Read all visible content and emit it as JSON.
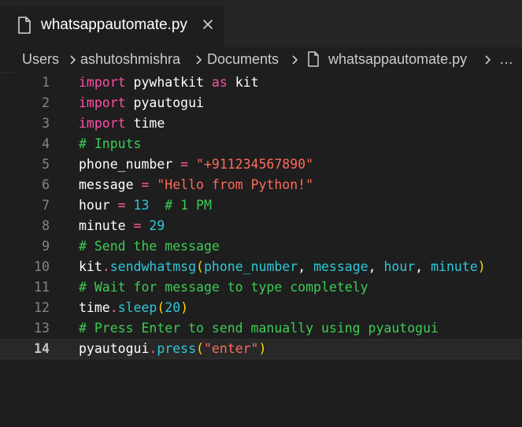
{
  "tab": {
    "label": "whatsappautomate.py",
    "icon": "file-icon",
    "close_icon": "close-icon"
  },
  "breadcrumb": {
    "items": [
      "Users",
      "ashutoshmishra",
      "Documents",
      "whatsappautomate.py",
      "…"
    ],
    "file_icon": "file-icon"
  },
  "editor": {
    "current_line": 14,
    "lines": [
      {
        "n": "1",
        "tokens": [
          [
            "kw",
            "import"
          ],
          [
            "id",
            " pywhatkit "
          ],
          [
            "kw",
            "as"
          ],
          [
            "id",
            " kit"
          ]
        ]
      },
      {
        "n": "2",
        "tokens": [
          [
            "kw",
            "import"
          ],
          [
            "id",
            " pyautogui"
          ]
        ]
      },
      {
        "n": "3",
        "tokens": [
          [
            "kw",
            "import"
          ],
          [
            "id",
            " time"
          ]
        ]
      },
      {
        "n": "4",
        "tokens": [
          [
            "cm",
            "# Inputs"
          ]
        ]
      },
      {
        "n": "5",
        "tokens": [
          [
            "id",
            "phone_number "
          ],
          [
            "op",
            "="
          ],
          [
            "id",
            " "
          ],
          [
            "str",
            "\"+911234567890\""
          ]
        ]
      },
      {
        "n": "6",
        "tokens": [
          [
            "id",
            "message "
          ],
          [
            "op",
            "="
          ],
          [
            "id",
            " "
          ],
          [
            "str",
            "\"Hello from Python!\""
          ]
        ]
      },
      {
        "n": "7",
        "tokens": [
          [
            "id",
            "hour "
          ],
          [
            "op",
            "="
          ],
          [
            "id",
            " "
          ],
          [
            "num",
            "13"
          ],
          [
            "id",
            "  "
          ],
          [
            "cm",
            "# 1 PM"
          ]
        ]
      },
      {
        "n": "8",
        "tokens": [
          [
            "id",
            "minute "
          ],
          [
            "op",
            "="
          ],
          [
            "id",
            " "
          ],
          [
            "num",
            "29"
          ]
        ]
      },
      {
        "n": "9",
        "tokens": [
          [
            "cm",
            "# Send the message"
          ]
        ]
      },
      {
        "n": "10",
        "tokens": [
          [
            "id",
            "kit"
          ],
          [
            "op",
            "."
          ],
          [
            "fn",
            "sendwhatmsg"
          ],
          [
            "pn",
            "("
          ],
          [
            "param",
            "phone_number"
          ],
          [
            "id",
            ", "
          ],
          [
            "param",
            "message"
          ],
          [
            "id",
            ", "
          ],
          [
            "param",
            "hour"
          ],
          [
            "id",
            ", "
          ],
          [
            "param",
            "minute"
          ],
          [
            "pn",
            ")"
          ]
        ]
      },
      {
        "n": "11",
        "tokens": [
          [
            "cm",
            "# Wait for message to type completely"
          ]
        ]
      },
      {
        "n": "12",
        "tokens": [
          [
            "id",
            "time"
          ],
          [
            "op",
            "."
          ],
          [
            "fn",
            "sleep"
          ],
          [
            "pn",
            "("
          ],
          [
            "num",
            "20"
          ],
          [
            "pn",
            ")"
          ]
        ]
      },
      {
        "n": "13",
        "tokens": [
          [
            "cm",
            "# Press Enter to send manually using pyautogui"
          ]
        ]
      },
      {
        "n": "14",
        "tokens": [
          [
            "id",
            "pyautogui"
          ],
          [
            "op",
            "."
          ],
          [
            "fn",
            "press"
          ],
          [
            "pn",
            "("
          ],
          [
            "str",
            "\"enter\""
          ],
          [
            "pn",
            ")"
          ]
        ]
      }
    ]
  },
  "colors": {
    "background": "#1e1e1e",
    "tabbar": "#252526",
    "keyword": "#ff4fa8",
    "string": "#ff6a5a",
    "number": "#2ec8d8",
    "comment": "#3dcc55",
    "function": "#2ec8d8",
    "paren": "#ffd700"
  }
}
